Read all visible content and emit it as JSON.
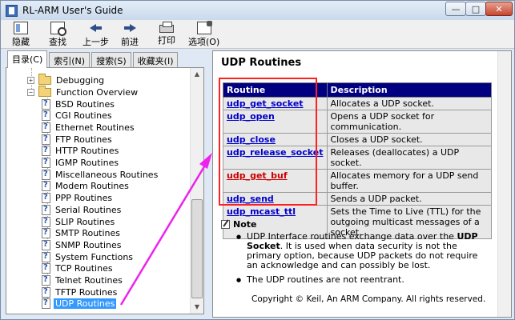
{
  "window": {
    "title": "RL-ARM User's Guide"
  },
  "titlebar_buttons": {
    "minimize": "—",
    "maximize": "□",
    "close": "✕"
  },
  "toolbar": [
    {
      "label": "隐藏",
      "icon": "hide-icon"
    },
    {
      "label": "查找",
      "icon": "find-icon"
    },
    {
      "label": "上一步",
      "icon": "back-icon"
    },
    {
      "label": "前进",
      "icon": "forward-icon"
    },
    {
      "label": "打印",
      "icon": "print-icon"
    },
    {
      "label": "选项(O)",
      "icon": "options-icon"
    }
  ],
  "tabs": [
    "目录(C)",
    "索引(N)",
    "搜索(S)",
    "收藏夹(I)"
  ],
  "tree": {
    "folders": [
      {
        "label": "Debugging",
        "expander": "+"
      },
      {
        "label": "Function Overview",
        "expander": "−"
      }
    ],
    "items": [
      "BSD Routines",
      "CGI Routines",
      "Ethernet Routines",
      "FTP Routines",
      "HTTP Routines",
      "IGMP Routines",
      "Miscellaneous  Routines",
      "Modem Routines",
      "PPP Routines",
      "Serial Routines",
      "SLIP Routines",
      "SMTP Routines",
      "SNMP Routines",
      "System Functions",
      "TCP Routines",
      "Telnet Routines",
      "TFTP Routines",
      "UDP Routines"
    ],
    "selected": "UDP Routines"
  },
  "content": {
    "heading": "UDP Routines",
    "table": {
      "headers": [
        "Routine",
        "Description"
      ],
      "rows": [
        {
          "routine": "udp_get_socket",
          "description": "Allocates a UDP socket."
        },
        {
          "routine": "udp_open",
          "description": "Opens a UDP socket for communication."
        },
        {
          "routine": "udp_close",
          "description": "Closes a UDP socket."
        },
        {
          "routine": "udp_release_socket",
          "description": "Releases (deallocates) a UDP socket."
        },
        {
          "routine": "udp_get_buf",
          "description": "Allocates memory for a UDP send buffer."
        },
        {
          "routine": "udp_send",
          "description": "Sends a UDP packet."
        },
        {
          "routine": "udp_mcast_ttl",
          "description": "Sets the Time to Live (TTL) for the outgoing multicast messages of a socket."
        }
      ],
      "highlighted_routine": "udp_get_buf"
    },
    "note_title": "Note",
    "notes": [
      {
        "before": "UDP Interface routines exchange data over the ",
        "bold": "UDP Socket",
        "after": ". It is used when data security is not the primary option, because UDP packets do not require an acknowledge and can possibly be lost."
      },
      {
        "before": "The UDP routines are not reentrant.",
        "bold": "",
        "after": ""
      }
    ],
    "copyright": "Copyright © Keil, An ARM Company. All rights reserved."
  },
  "colors": {
    "table_header": "#000080",
    "link": "#0000cc",
    "link_highlight": "#cc0000",
    "annotation_box": "#ff2020",
    "annotation_arrow": "#ee22ee",
    "selection": "#3399ff"
  }
}
